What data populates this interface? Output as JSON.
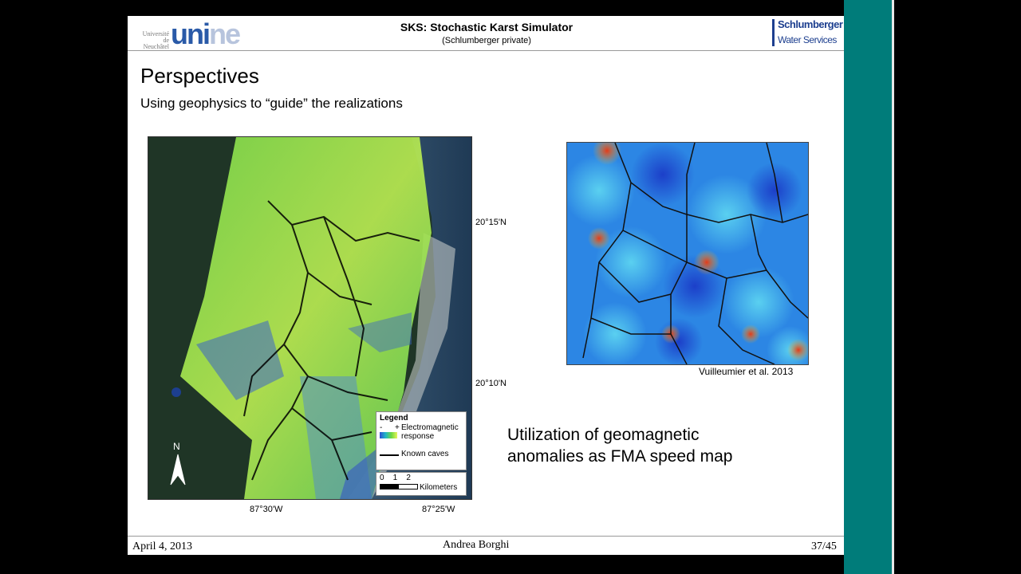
{
  "header": {
    "university_small": "Université de Neuchâtel",
    "logo_u": "uni",
    "logo_ne": "ne",
    "title": "SKS: Stochastic Karst Simulator",
    "subtitle": "(Schlumberger private)",
    "company": "Schlumberger",
    "division": "Water Services"
  },
  "slide": {
    "title": "Perspectives",
    "subtitle": "Using geophysics to “guide” the realizations",
    "statement": [
      "Utilization of geomagnetic",
      "anomalies as FMA speed map"
    ],
    "citation": "Vuilleumier et al. 2013"
  },
  "map": {
    "lat_labels": [
      "20°15'N",
      "20°10'N"
    ],
    "lon_labels": [
      "87°30'W",
      "87°25'W"
    ],
    "legend": {
      "title": "Legend",
      "minus": "-",
      "plus": "+",
      "em_label": "Electromagnetic response",
      "caves_label": "Known caves",
      "scale_numbers": "0    1    2",
      "scale_unit": "Kilometers"
    },
    "north_label": "N"
  },
  "footer": {
    "date": "April 4, 2013",
    "author": "Andrea Borghi",
    "page": "37/45"
  },
  "colors": {
    "teal_panel": "#007c7a",
    "logo_blue": "#2a5aa8",
    "brand_blue": "#1d3f8f"
  }
}
